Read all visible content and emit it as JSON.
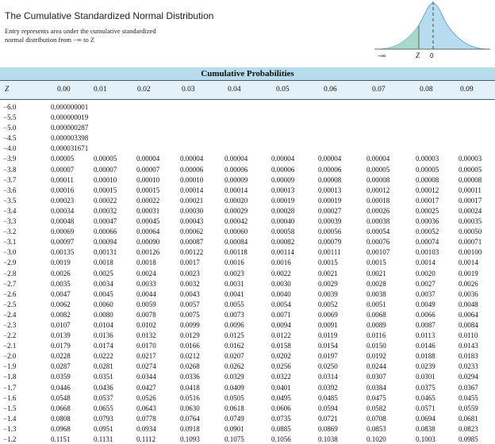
{
  "header": {
    "title": "The Cumulative Standardized Normal Distribution",
    "subtitle_line1": "Entry represents area under the cumulative standardized",
    "subtitle_line2": "normal distribution from −∞ to Z"
  },
  "figure": {
    "left_label": "−∞",
    "z_label": "Z",
    "zero_label": "0",
    "fill_color": "#a8d8c8",
    "curve_color": "#5fa8d8"
  },
  "table": {
    "caption": "Cumulative Probabilities",
    "z_header": "Z",
    "columns": [
      "0.00",
      "0.01",
      "0.02",
      "0.03",
      "0.04",
      "0.05",
      "0.06",
      "0.07",
      "0.08",
      "0.09"
    ],
    "rows": [
      {
        "z": "−6.0",
        "v": [
          "0.000000001"
        ]
      },
      {
        "z": "−5.5",
        "v": [
          "0.000000019"
        ]
      },
      {
        "z": "−5.0",
        "v": [
          "0.000000287"
        ]
      },
      {
        "z": "−4.5",
        "v": [
          "0.000003398"
        ]
      },
      {
        "z": "−4.0",
        "v": [
          "0.000031671"
        ]
      },
      {
        "z": "−3.9",
        "v": [
          "0.00005",
          "0.00005",
          "0.00004",
          "0.00004",
          "0.00004",
          "0.00004",
          "0.00004",
          "0.00004",
          "0.00003",
          "0.00003"
        ]
      },
      {
        "z": "−3.8",
        "v": [
          "0.00007",
          "0.00007",
          "0.00007",
          "0.00006",
          "0.00006",
          "0.00006",
          "0.00006",
          "0.00005",
          "0.00005",
          "0.00005"
        ]
      },
      {
        "z": "−3.7",
        "v": [
          "0.00011",
          "0.00010",
          "0.00010",
          "0.00010",
          "0.00009",
          "0.00009",
          "0.00008",
          "0.00008",
          "0.00008",
          "0.00008"
        ]
      },
      {
        "z": "−3.6",
        "v": [
          "0.00016",
          "0.00015",
          "0.00015",
          "0.00014",
          "0.00014",
          "0.00013",
          "0.00013",
          "0.00012",
          "0.00012",
          "0.00011"
        ]
      },
      {
        "z": "−3.5",
        "v": [
          "0.00023",
          "0.00022",
          "0.00022",
          "0.00021",
          "0.00020",
          "0.00019",
          "0.00019",
          "0.00018",
          "0.00017",
          "0.00017"
        ]
      },
      {
        "z": "−3.4",
        "v": [
          "0.00034",
          "0.00032",
          "0.00031",
          "0.00030",
          "0.00029",
          "0.00028",
          "0.00027",
          "0.00026",
          "0.00025",
          "0.00024"
        ]
      },
      {
        "z": "−3.3",
        "v": [
          "0.00048",
          "0.00047",
          "0.00045",
          "0.00043",
          "0.00042",
          "0.00040",
          "0.00039",
          "0.00038",
          "0.00036",
          "0.00035"
        ]
      },
      {
        "z": "−3.2",
        "v": [
          "0.00069",
          "0.00066",
          "0.00064",
          "0.00062",
          "0.00060",
          "0.00058",
          "0.00056",
          "0.00054",
          "0.00052",
          "0.00050"
        ]
      },
      {
        "z": "−3.1",
        "v": [
          "0.00097",
          "0.00094",
          "0.00090",
          "0.00087",
          "0.00084",
          "0.00082",
          "0.00079",
          "0.00076",
          "0.00074",
          "0.00071"
        ]
      },
      {
        "z": "−3.0",
        "v": [
          "0.00135",
          "0.00131",
          "0.00126",
          "0.00122",
          "0.00118",
          "0.00114",
          "0.00111",
          "0.00107",
          "0.00103",
          "0.00100"
        ]
      },
      {
        "z": "−2.9",
        "v": [
          "0.0019",
          "0.0018",
          "0.0018",
          "0.0017",
          "0.0016",
          "0.0016",
          "0.0015",
          "0.0015",
          "0.0014",
          "0.0014"
        ]
      },
      {
        "z": "−2.8",
        "v": [
          "0.0026",
          "0.0025",
          "0.0024",
          "0.0023",
          "0.0023",
          "0.0022",
          "0.0021",
          "0.0021",
          "0.0020",
          "0.0019"
        ]
      },
      {
        "z": "−2.7",
        "v": [
          "0.0035",
          "0.0034",
          "0.0033",
          "0.0032",
          "0.0031",
          "0.0030",
          "0.0029",
          "0.0028",
          "0.0027",
          "0.0026"
        ]
      },
      {
        "z": "−2.6",
        "v": [
          "0.0047",
          "0.0045",
          "0.0044",
          "0.0043",
          "0.0041",
          "0.0040",
          "0.0039",
          "0.0038",
          "0.0037",
          "0.0036"
        ]
      },
      {
        "z": "−2.5",
        "v": [
          "0.0062",
          "0.0060",
          "0.0059",
          "0.0057",
          "0.0055",
          "0.0054",
          "0.0052",
          "0.0051",
          "0.0049",
          "0.0048"
        ]
      },
      {
        "z": "−2.4",
        "v": [
          "0.0082",
          "0.0080",
          "0.0078",
          "0.0075",
          "0.0073",
          "0.0071",
          "0.0069",
          "0.0068",
          "0.0066",
          "0.0064"
        ]
      },
      {
        "z": "−2.3",
        "v": [
          "0.0107",
          "0.0104",
          "0.0102",
          "0.0099",
          "0.0096",
          "0.0094",
          "0.0091",
          "0.0089",
          "0.0087",
          "0.0084"
        ]
      },
      {
        "z": "−2.2",
        "v": [
          "0.0139",
          "0.0136",
          "0.0132",
          "0.0129",
          "0.0125",
          "0.0122",
          "0.0119",
          "0.0116",
          "0.0113",
          "0.0110"
        ]
      },
      {
        "z": "−2.1",
        "v": [
          "0.0179",
          "0.0174",
          "0.0170",
          "0.0166",
          "0.0162",
          "0.0158",
          "0.0154",
          "0.0150",
          "0.0146",
          "0.0143"
        ]
      },
      {
        "z": "−2.0",
        "v": [
          "0.0228",
          "0.0222",
          "0.0217",
          "0.0212",
          "0.0207",
          "0.0202",
          "0.0197",
          "0.0192",
          "0.0188",
          "0.0183"
        ]
      },
      {
        "z": "−1.9",
        "v": [
          "0.0287",
          "0.0281",
          "0.0274",
          "0.0268",
          "0.0262",
          "0.0256",
          "0.0250",
          "0.0244",
          "0.0239",
          "0.0233"
        ]
      },
      {
        "z": "−1.8",
        "v": [
          "0.0359",
          "0.0351",
          "0.0344",
          "0.0336",
          "0.0329",
          "0.0322",
          "0.0314",
          "0.0307",
          "0.0301",
          "0.0294"
        ]
      },
      {
        "z": "−1.7",
        "v": [
          "0.0446",
          "0.0436",
          "0.0427",
          "0.0418",
          "0.0409",
          "0.0401",
          "0.0392",
          "0.0384",
          "0.0375",
          "0.0367"
        ]
      },
      {
        "z": "−1.6",
        "v": [
          "0.0548",
          "0.0537",
          "0.0526",
          "0.0516",
          "0.0505",
          "0.0495",
          "0.0485",
          "0.0475",
          "0.0465",
          "0.0455"
        ]
      },
      {
        "z": "−1.5",
        "v": [
          "0.0668",
          "0.0655",
          "0.0643",
          "0.0630",
          "0.0618",
          "0.0606",
          "0.0594",
          "0.0582",
          "0.0571",
          "0.0559"
        ]
      },
      {
        "z": "−1.4",
        "v": [
          "0.0808",
          "0.0793",
          "0.0778",
          "0.0764",
          "0.0749",
          "0.0735",
          "0.0721",
          "0.0708",
          "0.0694",
          "0.0681"
        ]
      },
      {
        "z": "−1.3",
        "v": [
          "0.0968",
          "0.0951",
          "0.0934",
          "0.0918",
          "0.0901",
          "0.0885",
          "0.0869",
          "0.0853",
          "0.0838",
          "0.0823"
        ]
      },
      {
        "z": "−1.2",
        "v": [
          "0.1151",
          "0.1131",
          "0.1112",
          "0.1093",
          "0.1075",
          "0.1056",
          "0.1038",
          "0.1020",
          "0.1003",
          "0.0985"
        ]
      }
    ]
  }
}
